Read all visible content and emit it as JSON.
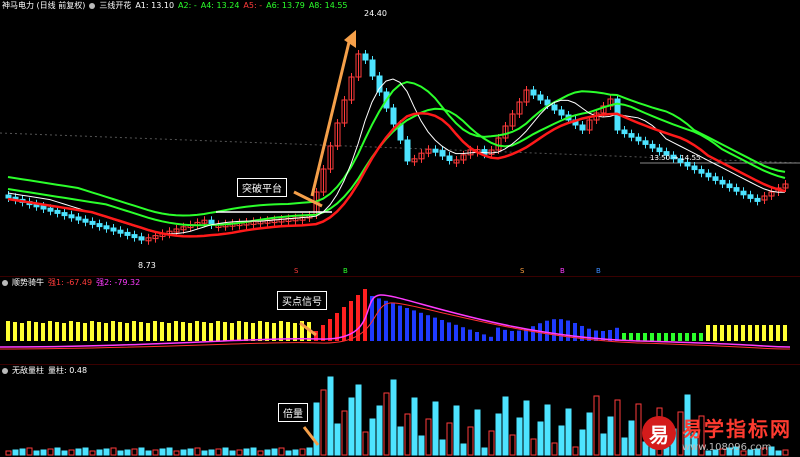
{
  "main": {
    "title": "神马电力 (日线 前复权)",
    "indicator": "三线开花",
    "a1": "A1: 13.10",
    "a2": "A2: -",
    "a4": "A4: 13.24",
    "a5": "A5: -",
    "a6": "A6: 13.79",
    "a8": "A8: 14.55",
    "high_label": "24.40",
    "low_label": "8.73",
    "right_label": "13.50 → 14.55",
    "callout": "突破平台",
    "colors": {
      "up": "#ff3b3b",
      "down": "#4de3ff",
      "ma_red": "#ff1a1a",
      "ma_green": "#2bff2b",
      "ma_white": "#ffffff"
    },
    "markers": [
      "S",
      "B",
      "S",
      "B",
      "B"
    ]
  },
  "trend": {
    "title": "顺势骑牛",
    "v1": "强1: -67.49",
    "v2": "强2: -79.32",
    "callout": "买点信号"
  },
  "volume": {
    "title": "无敌量柱",
    "value": "量柱: 0.48",
    "callout": "倍量"
  },
  "watermark": {
    "logo": "易",
    "title": "易学指标网",
    "url": "www.108096.com"
  }
}
